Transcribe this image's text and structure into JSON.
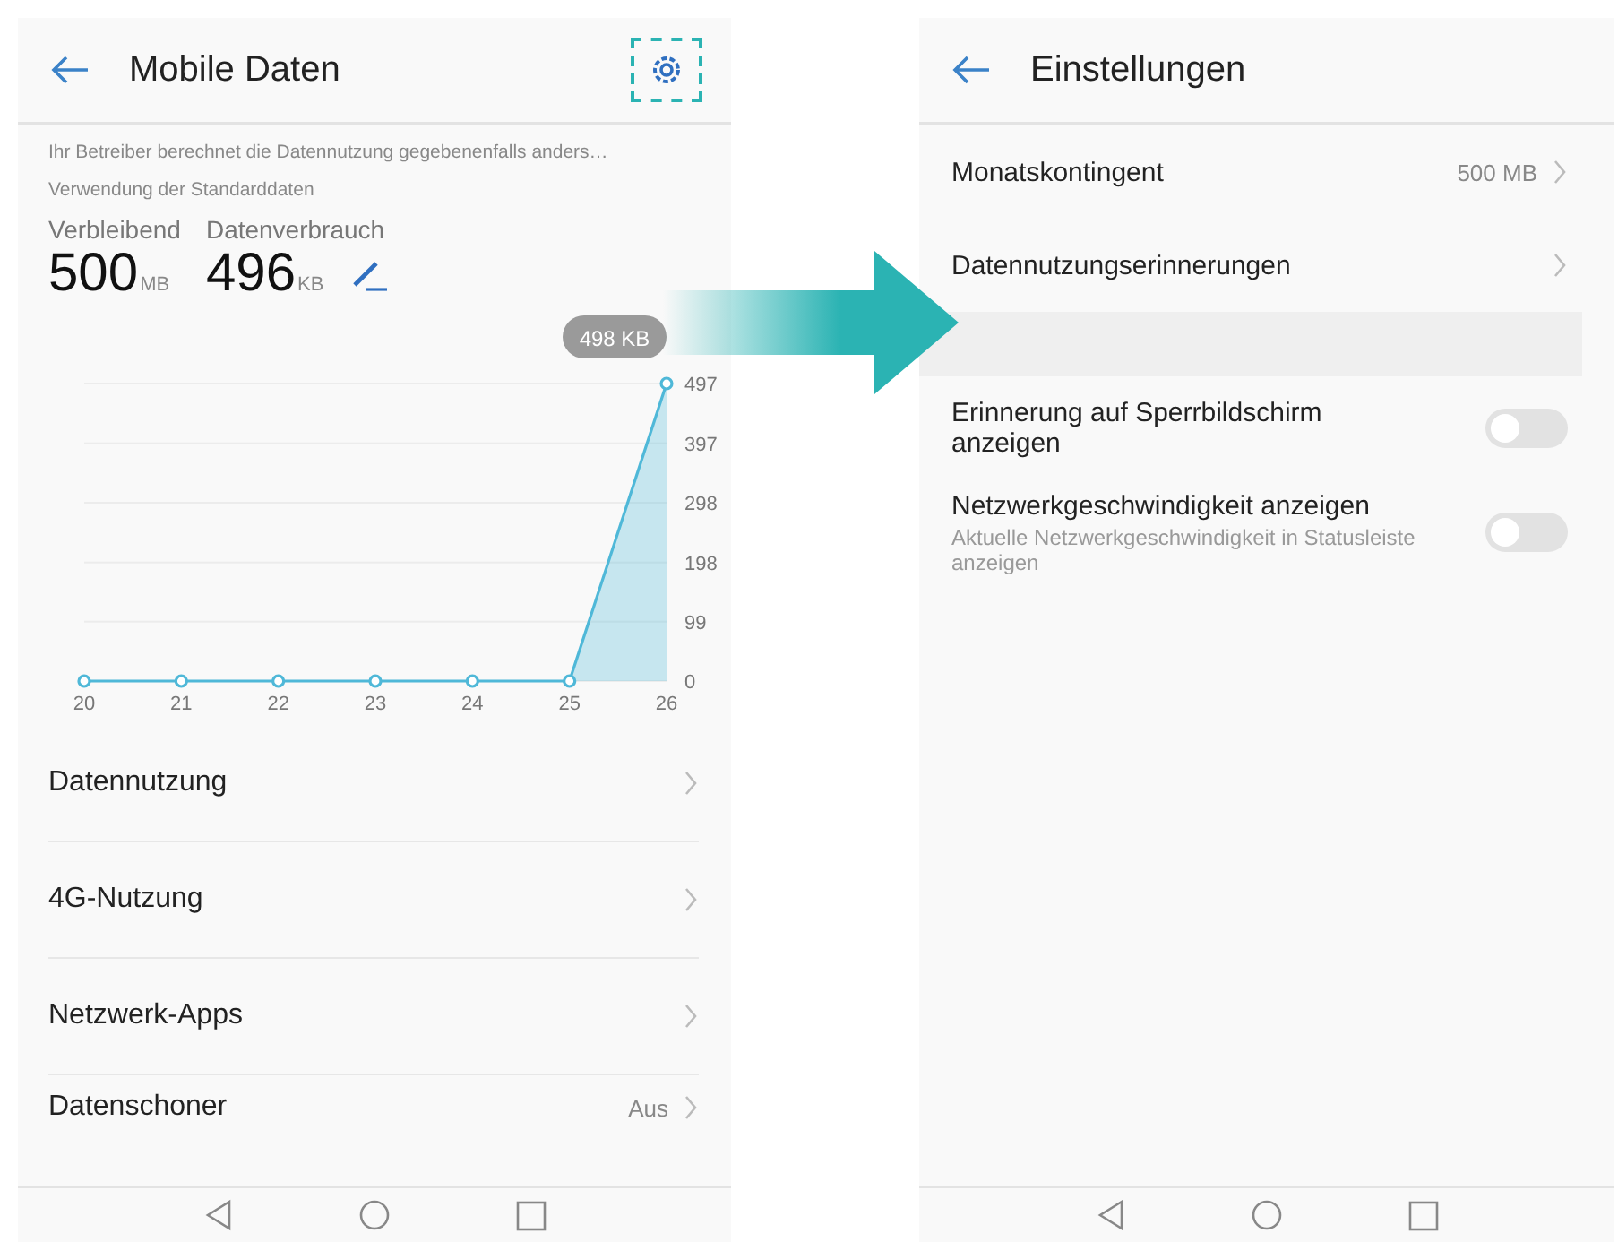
{
  "screens": [
    {
      "title": "Mobile Daten",
      "settings_highlighted": true,
      "notice": "Ihr Betreiber berechnet die Datennutzung gegebenenfalls anders…",
      "subtitle": "Verwendung der Standarddaten",
      "stats": [
        {
          "label": "Verbleibend",
          "value": "500",
          "unit": "MB"
        },
        {
          "label": "Datenverbrauch",
          "value": "496",
          "unit": "KB",
          "editable": true
        }
      ],
      "chart_data": {
        "type": "line",
        "categories": [
          "20",
          "21",
          "22",
          "23",
          "24",
          "25",
          "26"
        ],
        "series": [
          {
            "color": "#4fb8d8",
            "marker": true,
            "values": [
              0,
              0,
              0,
              0,
              0,
              0,
              497
            ]
          }
        ],
        "ylim": [
          0,
          497
        ],
        "grid": true,
        "yticks": [
          0,
          99,
          198,
          298,
          397,
          497
        ],
        "annotations": [
          "498 KB"
        ]
      },
      "items": [
        {
          "label": "Datennutzung"
        },
        {
          "label": "4G-Nutzung"
        },
        {
          "label": "Netzwerk-Apps"
        },
        {
          "label": "Datenschoner",
          "value": "Aus"
        }
      ]
    },
    {
      "title": "Einstellungen",
      "items": [
        {
          "kind": "link",
          "label": "Monatskontingent",
          "value": "500 MB"
        },
        {
          "kind": "link",
          "label": "Datennutzungserinnerungen"
        },
        {
          "kind": "spacer"
        },
        {
          "kind": "toggle",
          "label": "Erinnerung auf Sperrbildschirm anzeigen",
          "on": false
        },
        {
          "kind": "toggle",
          "label": "Netzwerkgeschwindigkeit anzeigen",
          "description": "Aktuelle Netzwerkgeschwindigkeit in Statusleiste anzeigen",
          "on": false
        }
      ]
    }
  ]
}
